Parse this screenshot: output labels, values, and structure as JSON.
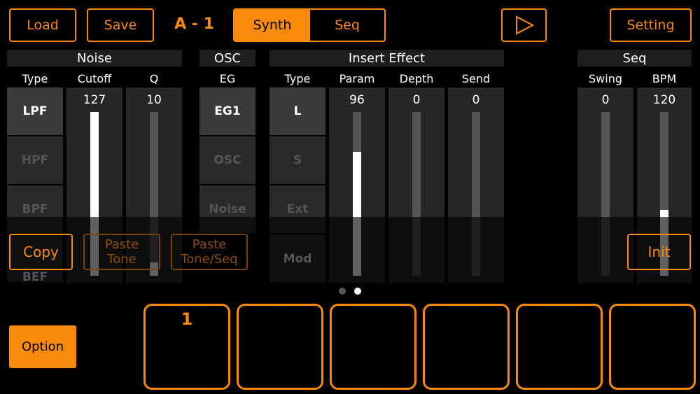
{
  "toolbar": {
    "load": "Load",
    "save": "Save",
    "patch": "A - 1",
    "tabs": [
      {
        "label": "Synth",
        "active": true
      },
      {
        "label": "Seq",
        "active": false
      }
    ],
    "play_icon": "play-icon",
    "setting": "Setting"
  },
  "accent": "#f98a0b",
  "noise": {
    "title": "Noise",
    "type_label": "Type",
    "types": [
      "LPF",
      "HPF",
      "BPF",
      "BEF"
    ],
    "selected": 0,
    "cutoff": {
      "label": "Cutoff",
      "value": "127",
      "level": 1.0
    },
    "q": {
      "label": "Q",
      "value": "10",
      "level": 0.08
    }
  },
  "osc": {
    "title": "OSC",
    "eg_label": "EG",
    "options": [
      "EG1",
      "OSC",
      "Noise"
    ],
    "selected": 0
  },
  "insert": {
    "title": "Insert Effect",
    "type_label": "Type",
    "types": [
      "L",
      "S",
      "Ext",
      "Mod"
    ],
    "selected": 0,
    "param": {
      "label": "Param",
      "value": "96",
      "level": 0.756
    },
    "depth": {
      "label": "Depth",
      "value": "0",
      "level": 0
    },
    "send": {
      "label": "Send",
      "value": "0",
      "level": 0
    }
  },
  "seq": {
    "title": "Seq",
    "swing": {
      "label": "Swing",
      "value": "0",
      "level": 0
    },
    "bpm": {
      "label": "BPM",
      "value": "120",
      "level": 0.4
    }
  },
  "overlay": {
    "copy": "Copy",
    "paste_tone": "Paste\nTone",
    "paste_tone_seq": "Paste\nTone/Seq",
    "init": "Init"
  },
  "pager": {
    "pages": 2,
    "current": 2
  },
  "option": "Option",
  "pads": [
    "1",
    "",
    "",
    "",
    "",
    ""
  ]
}
